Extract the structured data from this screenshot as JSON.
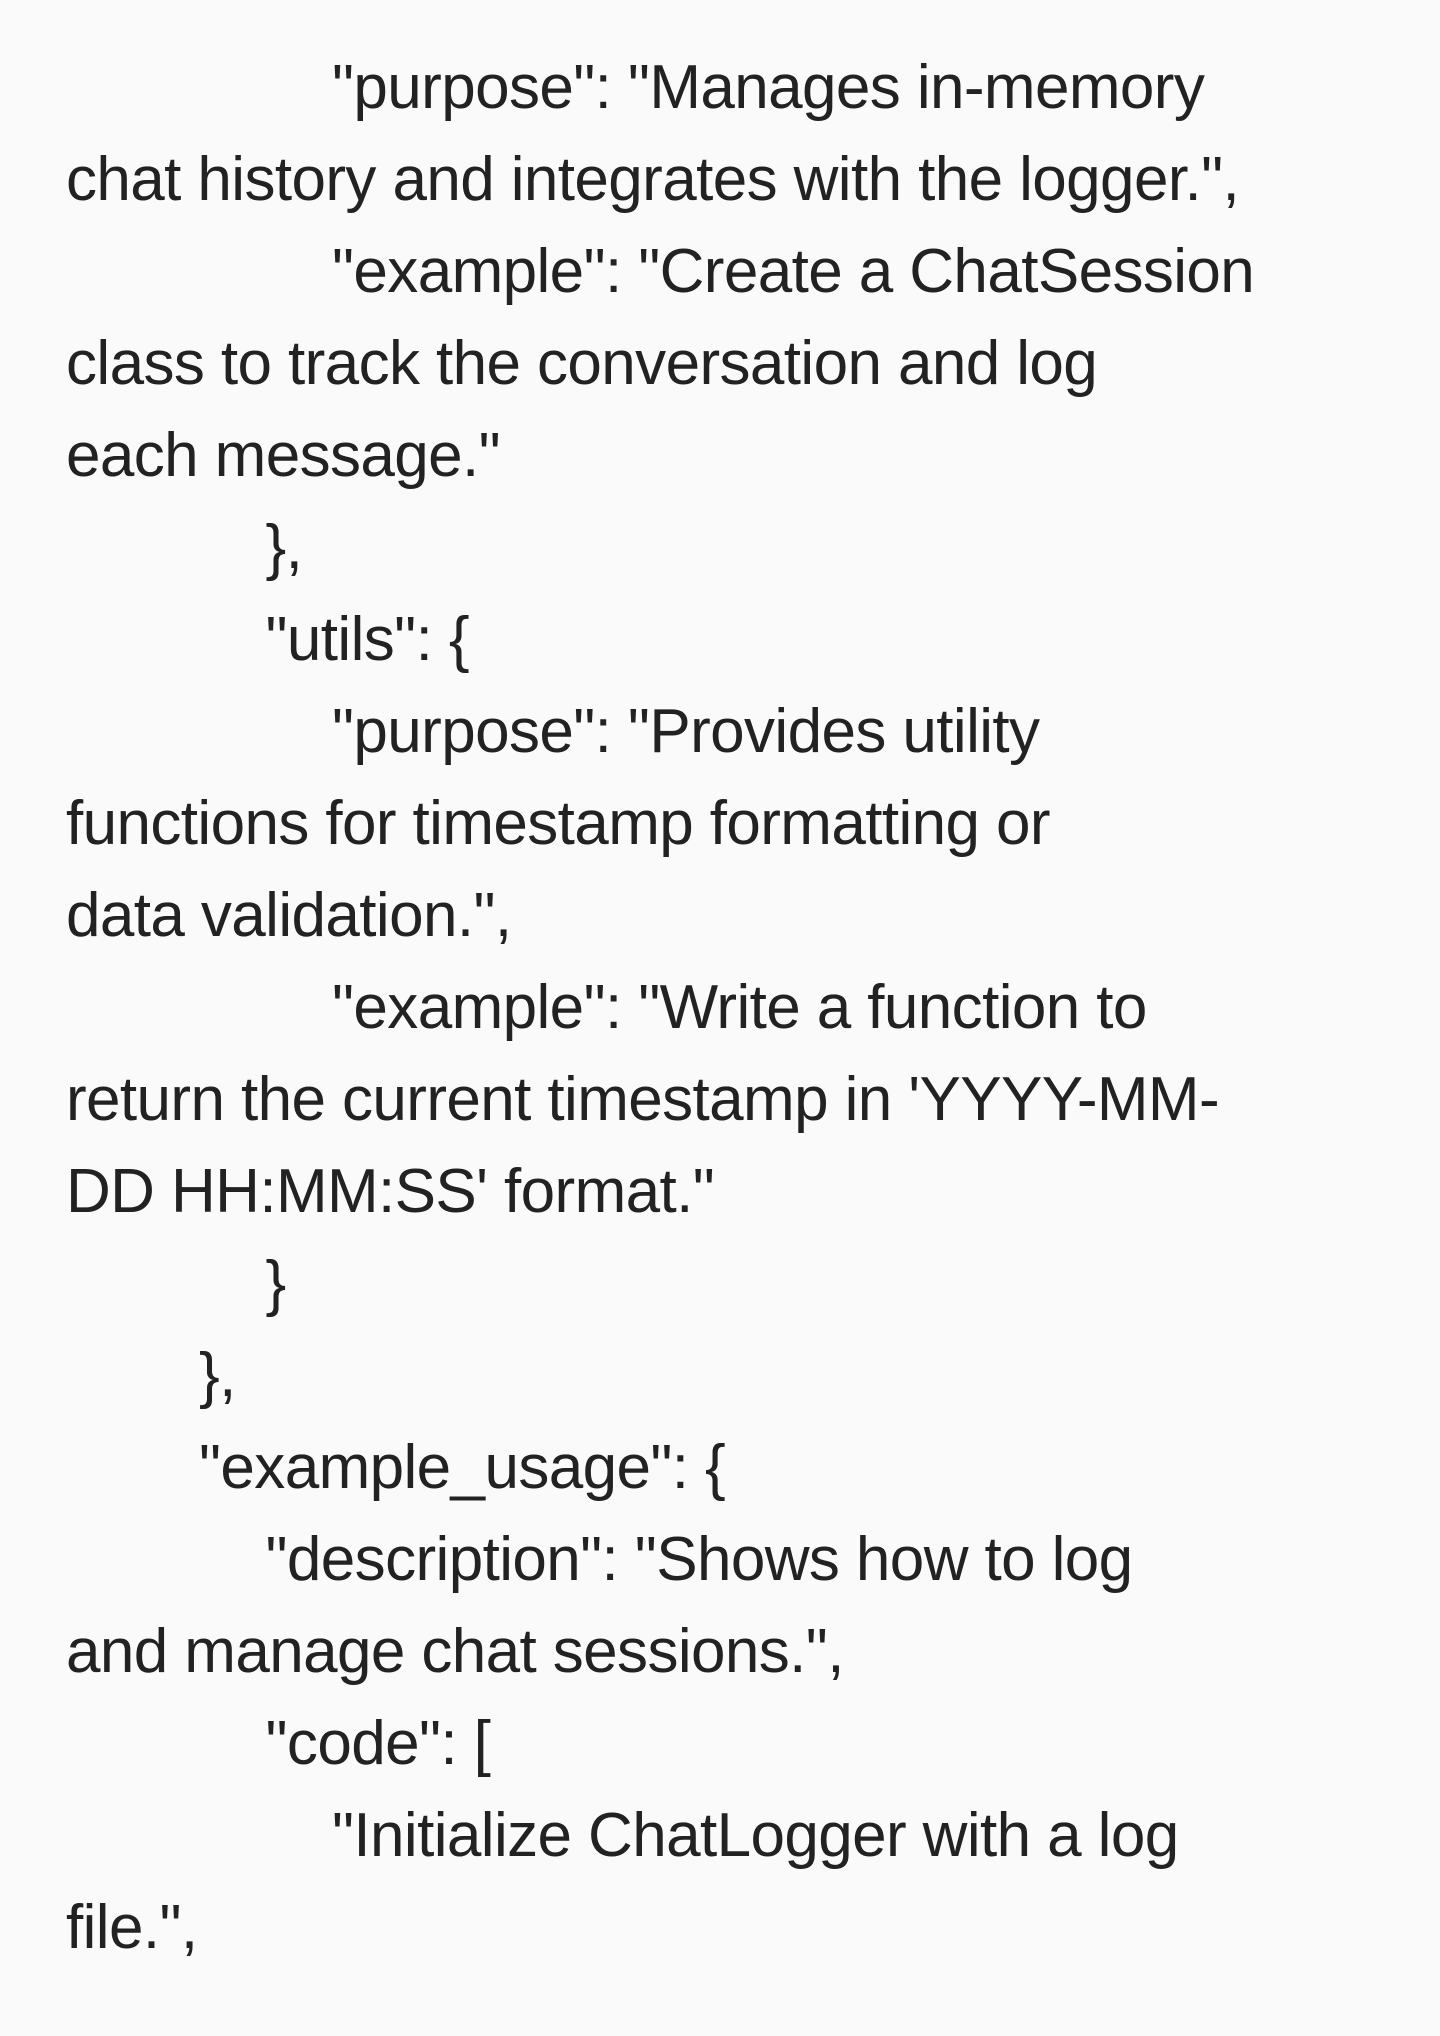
{
  "lines": [
    "                \"purpose\": \"Manages in-memory",
    "chat history and integrates with the logger.\",",
    "                \"example\": \"Create a ChatSession",
    "class to track the conversation and log",
    "each message.\"",
    "            },",
    "            \"utils\": {",
    "                \"purpose\": \"Provides utility",
    "functions for timestamp formatting or",
    "data validation.\",",
    "                \"example\": \"Write a function to",
    "return the current timestamp in 'YYYY-MM-",
    "DD HH:MM:SS' format.\"",
    "            }",
    "        },",
    "        \"example_usage\": {",
    "            \"description\": \"Shows how to log",
    "and manage chat sessions.\",",
    "            \"code\": [",
    "                \"Initialize ChatLogger with a log",
    "file.\","
  ]
}
